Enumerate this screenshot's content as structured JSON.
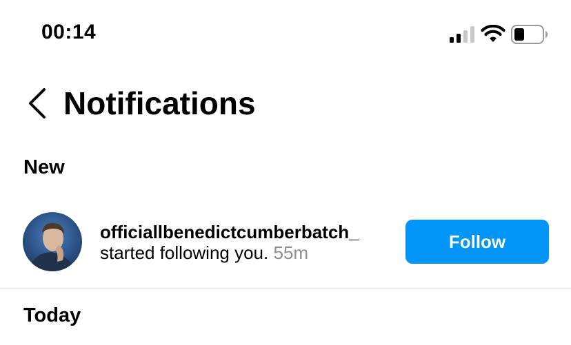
{
  "status_bar": {
    "time": "00:14",
    "icons": [
      "signal-icon",
      "wifi-icon",
      "battery-icon"
    ],
    "battery_level": 0.35
  },
  "header": {
    "back_icon": "chevron-left-icon",
    "title": "Notifications"
  },
  "sections": {
    "new": "New",
    "today": "Today"
  },
  "notification": {
    "username": "officiallbenedictcumberbatch_",
    "message": "started following you.",
    "time": "55m",
    "button_label": "Follow"
  },
  "colors": {
    "accent": "#0095f6",
    "secondary_text": "#8e8e8e",
    "divider": "#dbdbdb"
  }
}
